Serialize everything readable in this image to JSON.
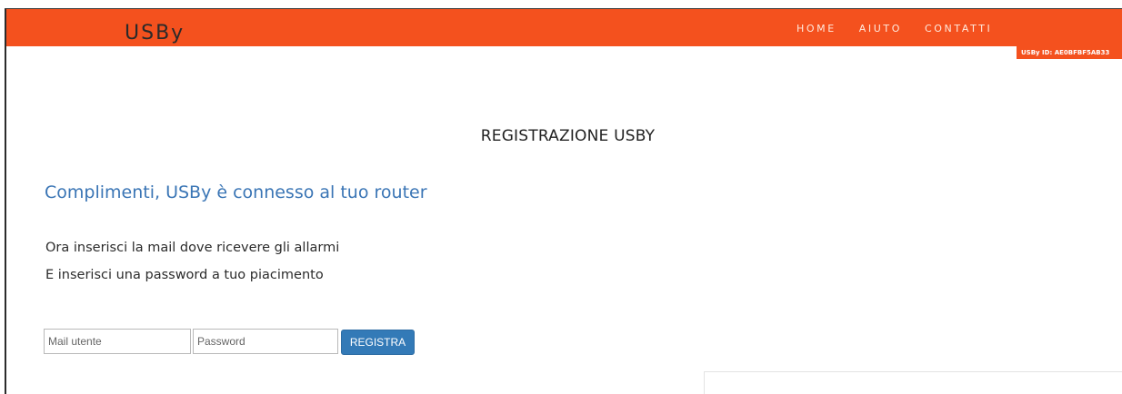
{
  "brand": {
    "name": "USBy"
  },
  "nav": {
    "items": [
      {
        "label": "HOME"
      },
      {
        "label": "AIUTO"
      },
      {
        "label": "CONTATTI"
      }
    ]
  },
  "badge": {
    "text": "USBy ID: AE0BFBF5AB33"
  },
  "main": {
    "title": "REGISTRAZIONE USBY",
    "subtitle": "Complimenti, USBy è connesso al tuo router",
    "instructions": [
      "Ora inserisci la mail dove ricevere gli allarmi",
      "E inserisci una password a tuo piacimento"
    ]
  },
  "form": {
    "email_placeholder": "Mail utente",
    "password_placeholder": "Password",
    "submit_label": "REGISTRA"
  },
  "colors": {
    "navbar": "#f4511e",
    "accent_text": "#3a75b5",
    "button": "#337ab7"
  }
}
